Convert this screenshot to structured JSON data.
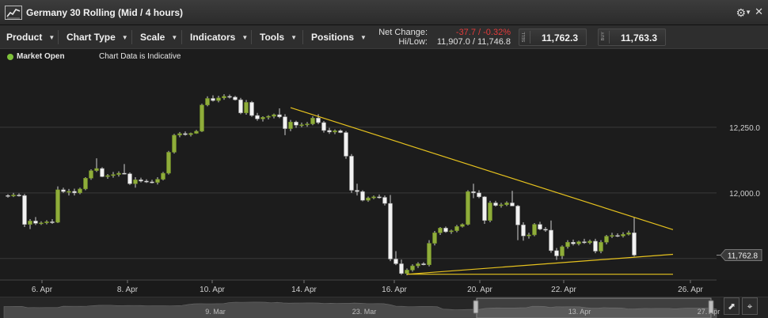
{
  "window": {
    "title": "Germany 30 Rolling (Mid / 4 hours)"
  },
  "toolbar": {
    "menus": [
      {
        "label": "Product"
      },
      {
        "label": "Chart Type"
      },
      {
        "label": "Scale"
      },
      {
        "label": "Indicators"
      },
      {
        "label": "Tools"
      },
      {
        "label": "Positions"
      }
    ]
  },
  "stats": {
    "net_change_label": "Net Change:",
    "net_change_value": "-37.7 / -0.32%",
    "hilow_label": "Hi/Low:",
    "hilow_value": "11,907.0 / 11,746.8"
  },
  "trade": {
    "sell_tag": "SELL",
    "sell_price": "11,762.3",
    "buy_tag": "BUY",
    "buy_price": "11,763.3"
  },
  "status": {
    "market": "Market Open",
    "note": "Chart Data is Indicative"
  },
  "colors": {
    "up_candle": "#8fad3a",
    "down_candle": "#f2f2f2",
    "trendline": "#e6c21e",
    "status_open": "#7ec23a",
    "negative": "#e23b3b"
  },
  "icons": {
    "logo": "chart-line-icon",
    "settings": "gear-icon",
    "close": "close-icon",
    "pointer": "pointer-icon",
    "crosshair": "crosshair-icon"
  },
  "chart_data": {
    "type": "candlestick",
    "title": "",
    "ylim": [
      11668,
      12500
    ],
    "y_ticks": [
      11750,
      12000,
      12250
    ],
    "y_tick_labels": [
      "",
      "12,000.0",
      "12,250.0"
    ],
    "x_tick_labels": [
      "6. Apr",
      "8. Apr",
      "10. Apr",
      "14. Apr",
      "16. Apr",
      "20. Apr",
      "22. Apr",
      "26. Apr"
    ],
    "last_price_label": "11,762.8",
    "last_price": 11762.8,
    "grid": true,
    "candles": [
      {
        "o": 11990,
        "h": 11995,
        "l": 11982,
        "c": 11988
      },
      {
        "o": 11988,
        "h": 12000,
        "l": 11984,
        "c": 11992
      },
      {
        "o": 11992,
        "h": 11998,
        "l": 11986,
        "c": 11990
      },
      {
        "o": 11990,
        "h": 11996,
        "l": 11870,
        "c": 11880
      },
      {
        "o": 11880,
        "h": 11900,
        "l": 11862,
        "c": 11893
      },
      {
        "o": 11893,
        "h": 11908,
        "l": 11878,
        "c": 11884
      },
      {
        "o": 11884,
        "h": 11892,
        "l": 11878,
        "c": 11886
      },
      {
        "o": 11886,
        "h": 11896,
        "l": 11880,
        "c": 11890
      },
      {
        "o": 11890,
        "h": 11900,
        "l": 11882,
        "c": 11888
      },
      {
        "o": 11888,
        "h": 12025,
        "l": 11885,
        "c": 12012
      },
      {
        "o": 12012,
        "h": 12020,
        "l": 12000,
        "c": 12005
      },
      {
        "o": 12005,
        "h": 12015,
        "l": 11990,
        "c": 12006
      },
      {
        "o": 12006,
        "h": 12016,
        "l": 11990,
        "c": 12000
      },
      {
        "o": 12000,
        "h": 12020,
        "l": 11995,
        "c": 12015
      },
      {
        "o": 12015,
        "h": 12060,
        "l": 12010,
        "c": 12056
      },
      {
        "o": 12056,
        "h": 12090,
        "l": 12050,
        "c": 12085
      },
      {
        "o": 12085,
        "h": 12132,
        "l": 12080,
        "c": 12093
      },
      {
        "o": 12093,
        "h": 12098,
        "l": 12060,
        "c": 12062
      },
      {
        "o": 12062,
        "h": 12072,
        "l": 12054,
        "c": 12066
      },
      {
        "o": 12066,
        "h": 12080,
        "l": 12058,
        "c": 12070
      },
      {
        "o": 12070,
        "h": 12082,
        "l": 12062,
        "c": 12075
      },
      {
        "o": 12075,
        "h": 12110,
        "l": 12070,
        "c": 12073
      },
      {
        "o": 12073,
        "h": 12078,
        "l": 12030,
        "c": 12035
      },
      {
        "o": 12035,
        "h": 12060,
        "l": 12020,
        "c": 12050
      },
      {
        "o": 12050,
        "h": 12058,
        "l": 12040,
        "c": 12045
      },
      {
        "o": 12045,
        "h": 12052,
        "l": 12038,
        "c": 12042
      },
      {
        "o": 12042,
        "h": 12050,
        "l": 12036,
        "c": 12040
      },
      {
        "o": 12040,
        "h": 12060,
        "l": 12032,
        "c": 12052
      },
      {
        "o": 12052,
        "h": 12080,
        "l": 12048,
        "c": 12075
      },
      {
        "o": 12075,
        "h": 12160,
        "l": 12070,
        "c": 12155
      },
      {
        "o": 12155,
        "h": 12225,
        "l": 12150,
        "c": 12220
      },
      {
        "o": 12220,
        "h": 12232,
        "l": 12212,
        "c": 12226
      },
      {
        "o": 12226,
        "h": 12234,
        "l": 12218,
        "c": 12222
      },
      {
        "o": 12222,
        "h": 12230,
        "l": 12215,
        "c": 12227
      },
      {
        "o": 12227,
        "h": 12240,
        "l": 12225,
        "c": 12235
      },
      {
        "o": 12235,
        "h": 12340,
        "l": 12232,
        "c": 12335
      },
      {
        "o": 12335,
        "h": 12368,
        "l": 12330,
        "c": 12360
      },
      {
        "o": 12360,
        "h": 12372,
        "l": 12348,
        "c": 12352
      },
      {
        "o": 12352,
        "h": 12370,
        "l": 12345,
        "c": 12362
      },
      {
        "o": 12362,
        "h": 12376,
        "l": 12355,
        "c": 12368
      },
      {
        "o": 12368,
        "h": 12375,
        "l": 12360,
        "c": 12365
      },
      {
        "o": 12365,
        "h": 12370,
        "l": 12352,
        "c": 12355
      },
      {
        "o": 12355,
        "h": 12362,
        "l": 12300,
        "c": 12305
      },
      {
        "o": 12305,
        "h": 12354,
        "l": 12298,
        "c": 12345
      },
      {
        "o": 12345,
        "h": 12350,
        "l": 12290,
        "c": 12295
      },
      {
        "o": 12295,
        "h": 12305,
        "l": 12275,
        "c": 12282
      },
      {
        "o": 12282,
        "h": 12292,
        "l": 12272,
        "c": 12288
      },
      {
        "o": 12288,
        "h": 12296,
        "l": 12280,
        "c": 12292
      },
      {
        "o": 12292,
        "h": 12302,
        "l": 12284,
        "c": 12298
      },
      {
        "o": 12298,
        "h": 12322,
        "l": 12285,
        "c": 12290
      },
      {
        "o": 12290,
        "h": 12300,
        "l": 12220,
        "c": 12245
      },
      {
        "o": 12245,
        "h": 12278,
        "l": 12235,
        "c": 12270
      },
      {
        "o": 12270,
        "h": 12275,
        "l": 12248,
        "c": 12258
      },
      {
        "o": 12258,
        "h": 12268,
        "l": 12250,
        "c": 12260
      },
      {
        "o": 12260,
        "h": 12270,
        "l": 12252,
        "c": 12263
      },
      {
        "o": 12263,
        "h": 12292,
        "l": 12258,
        "c": 12285
      },
      {
        "o": 12285,
        "h": 12300,
        "l": 12262,
        "c": 12268
      },
      {
        "o": 12268,
        "h": 12274,
        "l": 12230,
        "c": 12238
      },
      {
        "o": 12238,
        "h": 12248,
        "l": 12225,
        "c": 12232
      },
      {
        "o": 12232,
        "h": 12242,
        "l": 12224,
        "c": 12237
      },
      {
        "o": 12237,
        "h": 12242,
        "l": 12228,
        "c": 12230
      },
      {
        "o": 12230,
        "h": 12236,
        "l": 12130,
        "c": 12140
      },
      {
        "o": 12140,
        "h": 12148,
        "l": 12000,
        "c": 12010
      },
      {
        "o": 12010,
        "h": 12035,
        "l": 11990,
        "c": 12005
      },
      {
        "o": 12005,
        "h": 12010,
        "l": 11968,
        "c": 11972
      },
      {
        "o": 11972,
        "h": 11986,
        "l": 11966,
        "c": 11981
      },
      {
        "o": 11981,
        "h": 11990,
        "l": 11976,
        "c": 11985
      },
      {
        "o": 11985,
        "h": 11994,
        "l": 11978,
        "c": 11983
      },
      {
        "o": 11983,
        "h": 11990,
        "l": 11952,
        "c": 11960
      },
      {
        "o": 11960,
        "h": 11992,
        "l": 11740,
        "c": 11748
      },
      {
        "o": 11748,
        "h": 11778,
        "l": 11725,
        "c": 11730
      },
      {
        "o": 11730,
        "h": 11746,
        "l": 11688,
        "c": 11693
      },
      {
        "o": 11693,
        "h": 11712,
        "l": 11686,
        "c": 11706
      },
      {
        "o": 11706,
        "h": 11728,
        "l": 11700,
        "c": 11722
      },
      {
        "o": 11722,
        "h": 11736,
        "l": 11714,
        "c": 11730
      },
      {
        "o": 11730,
        "h": 11736,
        "l": 11724,
        "c": 11726
      },
      {
        "o": 11726,
        "h": 11820,
        "l": 11720,
        "c": 11808
      },
      {
        "o": 11808,
        "h": 11855,
        "l": 11800,
        "c": 11848
      },
      {
        "o": 11848,
        "h": 11870,
        "l": 11840,
        "c": 11866
      },
      {
        "o": 11866,
        "h": 11872,
        "l": 11848,
        "c": 11852
      },
      {
        "o": 11852,
        "h": 11860,
        "l": 11844,
        "c": 11856
      },
      {
        "o": 11856,
        "h": 11878,
        "l": 11850,
        "c": 11872
      },
      {
        "o": 11872,
        "h": 11884,
        "l": 11868,
        "c": 11880
      },
      {
        "o": 11880,
        "h": 12010,
        "l": 11876,
        "c": 12005
      },
      {
        "o": 12005,
        "h": 12035,
        "l": 11980,
        "c": 12000
      },
      {
        "o": 12000,
        "h": 12010,
        "l": 11980,
        "c": 11985
      },
      {
        "o": 11985,
        "h": 11988,
        "l": 11882,
        "c": 11895
      },
      {
        "o": 11895,
        "h": 11970,
        "l": 11888,
        "c": 11962
      },
      {
        "o": 11962,
        "h": 11970,
        "l": 11948,
        "c": 11952
      },
      {
        "o": 11952,
        "h": 11962,
        "l": 11944,
        "c": 11955
      },
      {
        "o": 11955,
        "h": 11968,
        "l": 11950,
        "c": 11962
      },
      {
        "o": 11962,
        "h": 12008,
        "l": 11950,
        "c": 11950
      },
      {
        "o": 11950,
        "h": 11954,
        "l": 11820,
        "c": 11878
      },
      {
        "o": 11878,
        "h": 11888,
        "l": 11818,
        "c": 11836
      },
      {
        "o": 11836,
        "h": 11848,
        "l": 11826,
        "c": 11840
      },
      {
        "o": 11840,
        "h": 11885,
        "l": 11835,
        "c": 11880
      },
      {
        "o": 11880,
        "h": 11890,
        "l": 11858,
        "c": 11862
      },
      {
        "o": 11862,
        "h": 11870,
        "l": 11852,
        "c": 11858
      },
      {
        "o": 11858,
        "h": 11895,
        "l": 11772,
        "c": 11780
      },
      {
        "o": 11780,
        "h": 11790,
        "l": 11745,
        "c": 11760
      },
      {
        "o": 11760,
        "h": 11800,
        "l": 11748,
        "c": 11795
      },
      {
        "o": 11795,
        "h": 11820,
        "l": 11788,
        "c": 11812
      },
      {
        "o": 11812,
        "h": 11822,
        "l": 11800,
        "c": 11806
      },
      {
        "o": 11806,
        "h": 11818,
        "l": 11800,
        "c": 11814
      },
      {
        "o": 11814,
        "h": 11825,
        "l": 11806,
        "c": 11810
      },
      {
        "o": 11810,
        "h": 11822,
        "l": 11804,
        "c": 11816
      },
      {
        "o": 11816,
        "h": 11825,
        "l": 11770,
        "c": 11778
      },
      {
        "o": 11778,
        "h": 11820,
        "l": 11770,
        "c": 11812
      },
      {
        "o": 11812,
        "h": 11840,
        "l": 11804,
        "c": 11835
      },
      {
        "o": 11835,
        "h": 11848,
        "l": 11828,
        "c": 11838
      },
      {
        "o": 11838,
        "h": 11846,
        "l": 11832,
        "c": 11836
      },
      {
        "o": 11836,
        "h": 11850,
        "l": 11830,
        "c": 11842
      },
      {
        "o": 11842,
        "h": 11856,
        "l": 11838,
        "c": 11848
      },
      {
        "o": 11848,
        "h": 11907,
        "l": 11758,
        "c": 11763
      }
    ],
    "trendlines": [
      {
        "i1": 51,
        "v1": 12325,
        "i2": 120,
        "v2": 11860
      },
      {
        "i1": 72,
        "v1": 11690,
        "i2": 120,
        "v2": 11766
      },
      {
        "i1": 72,
        "v1": 11690,
        "i2": 120,
        "v2": 11690
      }
    ],
    "navigator": {
      "labels": [
        "9. Mar",
        "23. Mar",
        "13. Apr",
        "27. Apr"
      ]
    }
  }
}
